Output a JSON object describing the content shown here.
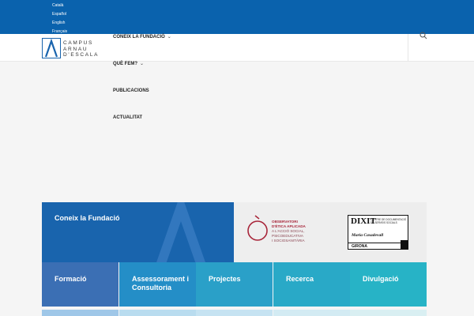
{
  "languages": [
    "Català",
    "Español",
    "English",
    "Français"
  ],
  "logo": {
    "line1": "CAMPUS",
    "line2": "ARNAU",
    "line3": "D'ESCALA"
  },
  "nav": {
    "items": [
      {
        "label": "CONEIX LA FUNDACIÓ",
        "caret": "⌄"
      },
      {
        "label": "QUÈ FEM?",
        "caret": "⌄"
      },
      {
        "label": "PUBLICACIONS"
      },
      {
        "label": "ACTUALITAT"
      }
    ]
  },
  "tiles": {
    "main_title": "Coneix la Fundació",
    "observatori": {
      "line1": "OBSERVATORI",
      "line2": "D'ÈTICA APLICADA",
      "line3": "A L'ACCIÓ SOCIAL,",
      "line4": "PSICOEDUCATIVA",
      "line5": "I SOCIOSANITÀRIA"
    },
    "dixit": {
      "title": "DIXIT",
      "sub1": "CENTRE DE DOCUMENTACIÓ",
      "sub2": "DE SERVEIS SOCIALS",
      "name1": "Maria Casadevall",
      "city": "GIRONA"
    },
    "row": [
      {
        "label": "Formació"
      },
      {
        "label": "Assessorament i Consultoria"
      },
      {
        "label": "Projectes"
      },
      {
        "label": "Recerca"
      },
      {
        "label": "Divulgació"
      }
    ]
  },
  "colors": {
    "topbar": "#0a62ad",
    "main_tile": "#1964ad",
    "accent_red": "#a8263a"
  }
}
